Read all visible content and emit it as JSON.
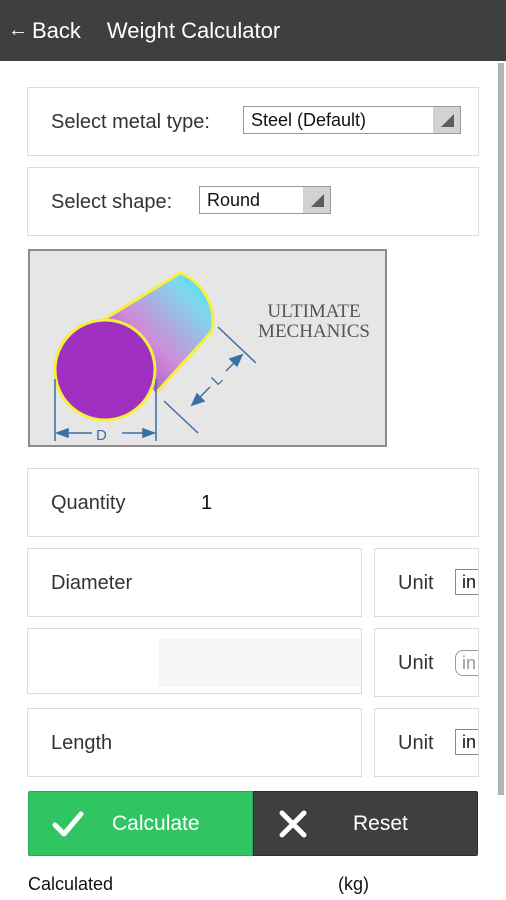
{
  "header": {
    "back_label": "Back",
    "back_icon": "arrow-left-icon",
    "title": "Weight Calculator"
  },
  "metal": {
    "label": "Select metal type:",
    "selected": "Steel (Default)"
  },
  "shape": {
    "label": "Select shape:",
    "selected": "Round"
  },
  "figure": {
    "brand_line1": "ULTIMATE",
    "brand_line2": "MECHANICS",
    "dim_diameter": "D",
    "dim_length": "L"
  },
  "quantity": {
    "label": "Quantity",
    "value": "1"
  },
  "fields": [
    {
      "label": "Diameter",
      "unit_label": "Unit",
      "unit_value": "in",
      "enabled": true
    },
    {
      "label": "",
      "unit_label": "Unit",
      "unit_value": "in",
      "enabled": false
    },
    {
      "label": "Length",
      "unit_label": "Unit",
      "unit_value": "in",
      "enabled": true
    }
  ],
  "buttons": {
    "calculate": {
      "label": "Calculate",
      "icon": "checkmark-icon",
      "color": "#30c462"
    },
    "reset": {
      "label": "Reset",
      "icon": "close-icon",
      "color": "#3f3f3f"
    }
  },
  "result": {
    "label": "Calculated",
    "unit": "(kg)"
  }
}
